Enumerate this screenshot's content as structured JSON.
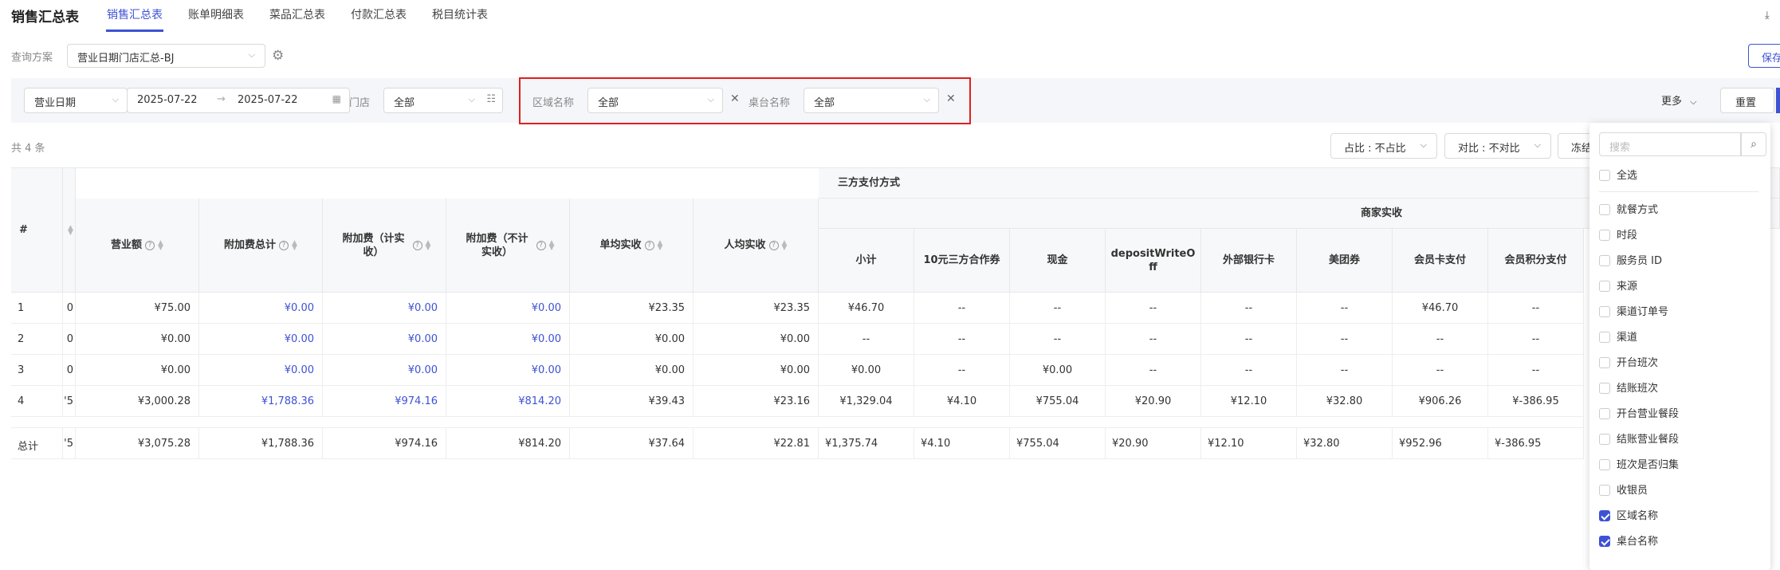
{
  "app_title": "销售汇总表",
  "tabs": [
    {
      "label": "销售汇总表",
      "active": true
    },
    {
      "label": "账单明细表"
    },
    {
      "label": "菜品汇总表"
    },
    {
      "label": "付款汇总表"
    },
    {
      "label": "税目统计表"
    }
  ],
  "query": {
    "label": "查询方案",
    "value": "营业日期门店汇总-BJ",
    "save_label": "保存"
  },
  "filters": {
    "date_type": "营业日期",
    "date_start": "2025-07-22",
    "date_end": "2025-07-22",
    "store_label": "门店",
    "store_value": "全部",
    "area_label": "区域名称",
    "area_value": "全部",
    "table_label": "桌台名称",
    "table_value": "全部",
    "more_label": "更多",
    "reset_label": "重置"
  },
  "toolbar": {
    "count_text": "共 4 条",
    "ratio_label": "占比 : 不占比",
    "compare_label": "对比 : 不对比",
    "freeze_label": "冻结"
  },
  "table": {
    "headers": {
      "idx": "#",
      "revenue": "营业额",
      "surcharge_total": "附加费总计",
      "surcharge_counted": "附加费（计实收）",
      "surcharge_uncounted": "附加费（不计实收）",
      "avg_per_bill": "单均实收",
      "avg_per_person": "人均实收",
      "third_party_group": "三方支付方式",
      "merchant_group": "商家实收",
      "subtotal": "小计",
      "coupon10": "10元三方合作券",
      "cash": "现金",
      "deposit": "depositWriteOff",
      "ext_bank": "外部银行卡",
      "meituan": "美团券",
      "member_card": "会员卡支付",
      "member_points": "会员积分支付"
    },
    "rows": [
      {
        "idx": "1",
        "frag": "0",
        "revenue": "¥75.00",
        "st": "¥0.00",
        "sc": "¥0.00",
        "su": "¥0.00",
        "ab": "¥23.35",
        "ap": "¥23.35",
        "sub": "¥46.70",
        "c10": "--",
        "cash": "--",
        "dep": "--",
        "bank": "--",
        "mt": "--",
        "mc": "¥46.70",
        "mp": "--"
      },
      {
        "idx": "2",
        "frag": "0",
        "revenue": "¥0.00",
        "st": "¥0.00",
        "sc": "¥0.00",
        "su": "¥0.00",
        "ab": "¥0.00",
        "ap": "¥0.00",
        "sub": "--",
        "c10": "--",
        "cash": "--",
        "dep": "--",
        "bank": "--",
        "mt": "--",
        "mc": "--",
        "mp": "--"
      },
      {
        "idx": "3",
        "frag": "0",
        "revenue": "¥0.00",
        "st": "¥0.00",
        "sc": "¥0.00",
        "su": "¥0.00",
        "ab": "¥0.00",
        "ap": "¥0.00",
        "sub": "¥0.00",
        "c10": "--",
        "cash": "¥0.00",
        "dep": "--",
        "bank": "--",
        "mt": "--",
        "mc": "--",
        "mp": "--"
      },
      {
        "idx": "4",
        "frag": "'5",
        "revenue": "¥3,000.28",
        "st": "¥1,788.36",
        "sc": "¥974.16",
        "su": "¥814.20",
        "ab": "¥39.43",
        "ap": "¥23.16",
        "sub": "¥1,329.04",
        "c10": "¥4.10",
        "cash": "¥755.04",
        "dep": "¥20.90",
        "bank": "¥12.10",
        "mt": "¥32.80",
        "mc": "¥906.26",
        "mp": "¥-386.95"
      }
    ],
    "total": {
      "idx": "总计",
      "frag": "'5",
      "revenue": "¥3,075.28",
      "st": "¥1,788.36",
      "sc": "¥974.16",
      "su": "¥814.20",
      "ab": "¥37.64",
      "ap": "¥22.81",
      "sub": "¥1,375.74",
      "c10": "¥4.10",
      "cash": "¥755.04",
      "dep": "¥20.90",
      "bank": "¥12.10",
      "mt": "¥32.80",
      "mc": "¥952.96",
      "mp": "¥-386.95"
    }
  },
  "more_dropdown": {
    "search_placeholder": "搜索",
    "select_all": "全选",
    "items": [
      {
        "label": "就餐方式",
        "checked": false
      },
      {
        "label": "时段",
        "checked": false
      },
      {
        "label": "服务员 ID",
        "checked": false
      },
      {
        "label": "来源",
        "checked": false
      },
      {
        "label": "渠道订单号",
        "checked": false
      },
      {
        "label": "渠道",
        "checked": false
      },
      {
        "label": "开台班次",
        "checked": false
      },
      {
        "label": "结账班次",
        "checked": false
      },
      {
        "label": "开台营业餐段",
        "checked": false
      },
      {
        "label": "结账营业餐段",
        "checked": false
      },
      {
        "label": "班次是否归集",
        "checked": false
      },
      {
        "label": "收银员",
        "checked": false
      },
      {
        "label": "区域名称",
        "checked": true
      },
      {
        "label": "桌台名称",
        "checked": true
      }
    ]
  },
  "colors": {
    "accent": "#3d52d5",
    "highlight": "#e02020"
  }
}
